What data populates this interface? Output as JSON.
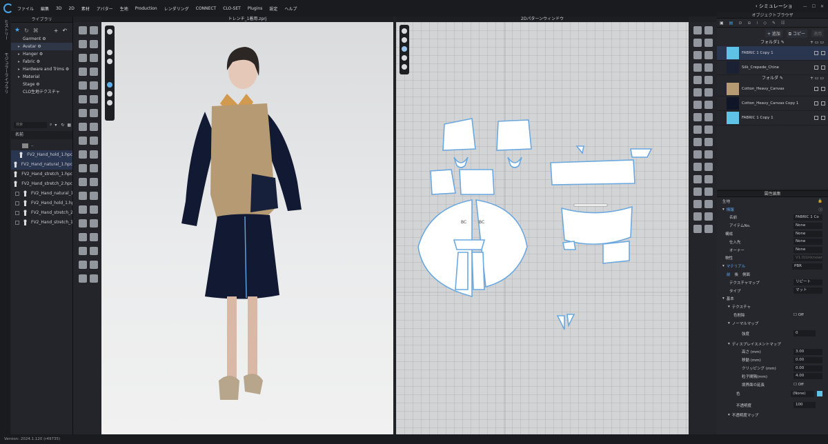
{
  "menubar": {
    "items": [
      "ファイル",
      "編集",
      "3D",
      "2D",
      "素材",
      "アバター",
      "生地",
      "Production",
      "レンダリング",
      "CONNECT",
      "CLO-SET",
      "Plugins",
      "設定",
      "ヘルプ"
    ],
    "mode": "シミュレーショ"
  },
  "leftstrip": {
    "tab1": "ヒストリー",
    "tab2": "モジュラーライブラリ"
  },
  "library": {
    "title": "ライブラリ",
    "tree": [
      {
        "label": "Garment",
        "arrow": false,
        "selected": false
      },
      {
        "label": "Avatar",
        "arrow": true,
        "selected": true
      },
      {
        "label": "Hanger",
        "arrow": true,
        "selected": false
      },
      {
        "label": "Fabric",
        "arrow": true,
        "selected": false
      },
      {
        "label": "Hardware and Trims",
        "arrow": true,
        "selected": false
      },
      {
        "label": "Material",
        "arrow": true,
        "selected": false
      },
      {
        "label": "Stage",
        "arrow": false,
        "selected": false
      },
      {
        "label": "CLO生地テクスチャ",
        "arrow": false,
        "selected": false
      }
    ],
    "search_placeholder": "検索",
    "name_header": "名前",
    "files": [
      {
        "label": "..",
        "selected": false
      },
      {
        "label": "FV2_Hand_hold_1.hpc",
        "selected": true
      },
      {
        "label": "FV2_Hand_natural_1.hpc",
        "selected": true
      },
      {
        "label": "FV2_Hand_stretch_1.hpc",
        "selected": false
      },
      {
        "label": "FV2_Hand_stretch_2.hpc",
        "selected": false
      },
      {
        "label": "FV2_Hand_natural_1.hpc",
        "selected": false
      },
      {
        "label": "FV2_Hand_hold_1.hpc",
        "selected": false
      },
      {
        "label": "FV2_Hand_stretch_2.hpc",
        "selected": false
      },
      {
        "label": "FV2_Hand_stretch_1.hpc",
        "selected": false
      }
    ]
  },
  "view3d": {
    "title": "トレンチ_1着用.zprj"
  },
  "view2d": {
    "title": "2Dパターンウィンドウ",
    "label1": "BC",
    "label2": "BC"
  },
  "objbrowser": {
    "title": "オブジェクトブラウザ",
    "add_label": "追加",
    "copy_label": "コピー",
    "apply_label": "適用",
    "folder1": "フォルダ1",
    "folder2": "フォルダ",
    "fabrics1": [
      {
        "name": "FABRIC 1 Copy 1",
        "color": "#5fc3e8",
        "selected": true
      },
      {
        "name": "Silk_Crepede_Chine",
        "color": "#1a2134",
        "selected": false
      }
    ],
    "fabrics2": [
      {
        "name": "Cotton_Heavy_Canvas",
        "color": "#b59a74",
        "selected": false
      },
      {
        "name": "Cotton_Heavy_Canvas Copy 1",
        "color": "#101628",
        "selected": false
      },
      {
        "name": "FABRIC 1 Copy 1",
        "color": "#5fc3e8",
        "selected": false
      }
    ]
  },
  "props": {
    "title": "属性編集",
    "tab": "生地",
    "info_section": "情報",
    "name_label": "名前",
    "name_value": "FABRIC 1 Co",
    "item_label": "アイテムNo.",
    "item_value": "None",
    "comp_label": "構成",
    "comp_value": "None",
    "supplier_label": "仕入先",
    "supplier_value": "None",
    "owner_label": "オーナー",
    "owner_value": "None",
    "physics_label": "物性",
    "physics_value": "V1.0(Unknown",
    "material_label": "マテリアル",
    "material_value": "PBR",
    "face_tabs": [
      "前",
      "後",
      "側面"
    ],
    "texmap_label": "テクスチャマップ",
    "texmap_value": "リピート",
    "type_label": "タイプ",
    "type_value": "マット",
    "basic_label": "基本",
    "texture_label": "テクスチャ",
    "decolor_label": "色削除",
    "decolor_value": "Off",
    "normal_label": "ノーマルマップ",
    "strength_label": "強度",
    "strength_value": "0",
    "disp_label": "ディスプレイスメントマップ",
    "height_label": "高さ (mm)",
    "height_value": "3.00",
    "shift_label": "移動 (mm)",
    "shift_value": "0.00",
    "clip_label": "クリッピング (mm)",
    "clip_value": "0.00",
    "particle_label": "粒子間隔(mm)",
    "particle_value": "4.00",
    "ext_label": "境界面の延長",
    "ext_value": "Off",
    "color_label": "色",
    "color_value": "(None)",
    "color_swatch": "#5fc3e8",
    "opacity_label": "不透明度",
    "opacity_value": "100",
    "opmap_label": "不透明度マップ"
  },
  "statusbar": {
    "version": "Version: 2024.1.120 (r49735)"
  }
}
